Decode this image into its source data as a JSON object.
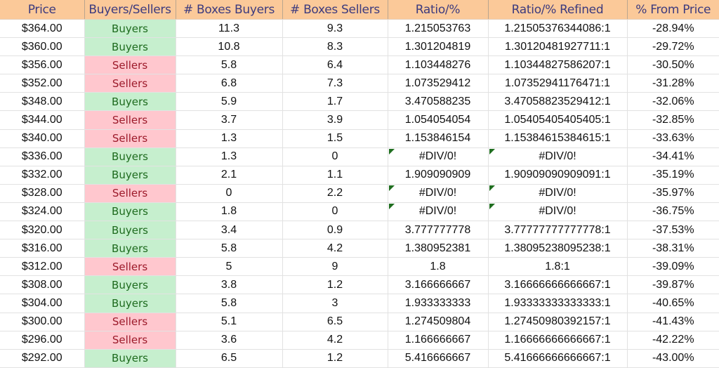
{
  "colors": {
    "header_bg": "#fbc999",
    "header_text": "#3d3b7e",
    "buyers_bg": "#c6efce",
    "buyers_text": "#1e6b1e",
    "sellers_bg": "#ffc7ce",
    "sellers_text": "#9c1a2a"
  },
  "columns": [
    "Price",
    "Buyers/Sellers",
    "# Boxes Buyers",
    "# Boxes Sellers",
    "Ratio/%",
    "Ratio/% Refined",
    "% From Price"
  ],
  "rows": [
    [
      "$364.00",
      "Buyers",
      "11.3",
      "9.3",
      "1.215053763",
      "1.21505376344086:1",
      "-28.94%"
    ],
    [
      "$360.00",
      "Buyers",
      "10.8",
      "8.3",
      "1.301204819",
      "1.30120481927711:1",
      "-29.72%"
    ],
    [
      "$356.00",
      "Sellers",
      "5.8",
      "6.4",
      "1.103448276",
      "1.10344827586207:1",
      "-30.50%"
    ],
    [
      "$352.00",
      "Sellers",
      "6.8",
      "7.3",
      "1.073529412",
      "1.07352941176471:1",
      "-31.28%"
    ],
    [
      "$348.00",
      "Buyers",
      "5.9",
      "1.7",
      "3.470588235",
      "3.47058823529412:1",
      "-32.06%"
    ],
    [
      "$344.00",
      "Sellers",
      "3.7",
      "3.9",
      "1.054054054",
      "1.05405405405405:1",
      "-32.85%"
    ],
    [
      "$340.00",
      "Sellers",
      "1.3",
      "1.5",
      "1.153846154",
      "1.15384615384615:1",
      "-33.63%"
    ],
    [
      "$336.00",
      "Buyers",
      "1.3",
      "0",
      "#DIV/0!",
      "#DIV/0!",
      "-34.41%"
    ],
    [
      "$332.00",
      "Buyers",
      "2.1",
      "1.1",
      "1.909090909",
      "1.90909090909091:1",
      "-35.19%"
    ],
    [
      "$328.00",
      "Sellers",
      "0",
      "2.2",
      "#DIV/0!",
      "#DIV/0!",
      "-35.97%"
    ],
    [
      "$324.00",
      "Buyers",
      "1.8",
      "0",
      "#DIV/0!",
      "#DIV/0!",
      "-36.75%"
    ],
    [
      "$320.00",
      "Buyers",
      "3.4",
      "0.9",
      "3.777777778",
      "3.77777777777778:1",
      "-37.53%"
    ],
    [
      "$316.00",
      "Buyers",
      "5.8",
      "4.2",
      "1.380952381",
      "1.38095238095238:1",
      "-38.31%"
    ],
    [
      "$312.00",
      "Sellers",
      "5",
      "9",
      "1.8",
      "1.8:1",
      "-39.09%"
    ],
    [
      "$308.00",
      "Buyers",
      "3.8",
      "1.2",
      "3.166666667",
      "3.16666666666667:1",
      "-39.87%"
    ],
    [
      "$304.00",
      "Buyers",
      "5.8",
      "3",
      "1.933333333",
      "1.93333333333333:1",
      "-40.65%"
    ],
    [
      "$300.00",
      "Sellers",
      "5.1",
      "6.5",
      "1.274509804",
      "1.27450980392157:1",
      "-41.43%"
    ],
    [
      "$296.00",
      "Sellers",
      "3.6",
      "4.2",
      "1.166666667",
      "1.16666666666667:1",
      "-42.22%"
    ],
    [
      "$292.00",
      "Buyers",
      "6.5",
      "1.2",
      "5.416666667",
      "5.41666666666667:1",
      "-43.00%"
    ]
  ]
}
